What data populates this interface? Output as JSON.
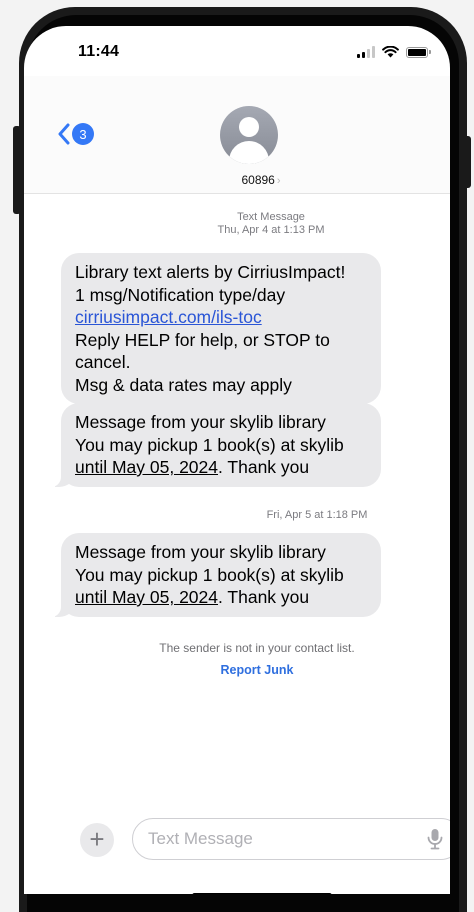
{
  "status_bar": {
    "time": "11:44",
    "icons": [
      "cellular-signal-icon",
      "wifi-icon",
      "battery-icon"
    ]
  },
  "header": {
    "back_badge_count": "3",
    "contact_name": "60896",
    "contact_chevron": "›",
    "icons": [
      "back-chevron-icon",
      "contact-avatar-icon"
    ]
  },
  "messages": {
    "timestamp_1": {
      "title": "Text Message",
      "date": "Thu, Apr 4 at 1:13 PM"
    },
    "bubble_1": {
      "line1": "Library text alerts by CirriusImpact!",
      "line2": "1 msg/Notification type/day",
      "link": "cirriusimpact.com/ils-toc",
      "line4": "Reply HELP for help, or STOP to",
      "line5": "cancel.",
      "line6": "Msg & data rates may apply"
    },
    "bubble_2": {
      "line1": "Message from your skylib library",
      "line2": "You may pickup 1 book(s) at skylib",
      "date_link": "until May 05, 2024",
      "suffix": ". Thank you"
    },
    "timestamp_2": "Fri, Apr 5 at 1:18 PM",
    "bubble_3": {
      "line1": "Message from your skylib library",
      "line2": "You may pickup 1 book(s) at skylib",
      "date_link": "until May 05, 2024",
      "suffix": ". Thank you"
    }
  },
  "sender_notice": "The sender is not in your contact list.",
  "report_junk_label": "Report Junk",
  "composer": {
    "plus_label": "+",
    "placeholder": "Text Message",
    "icons": [
      "plus-icon",
      "microphone-icon"
    ]
  },
  "colors": {
    "accent": "#3478f6",
    "link": "#2a55d6",
    "bubble": "#e9e9eb",
    "frame": "#1a1a1a"
  }
}
